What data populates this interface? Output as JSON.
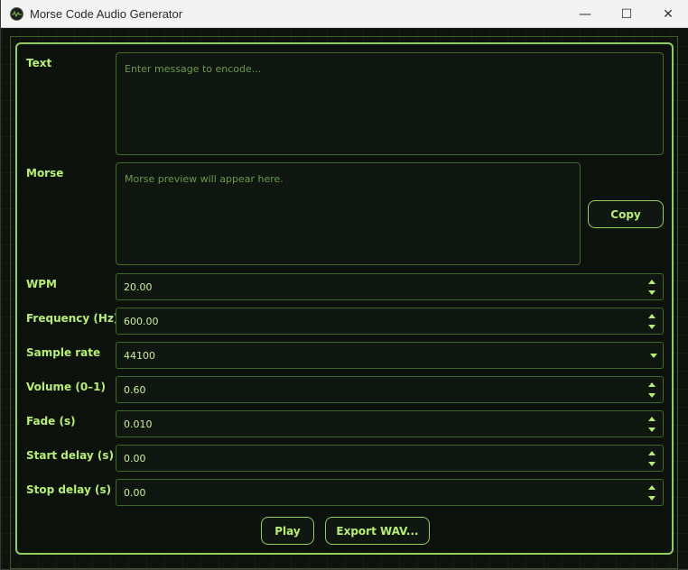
{
  "window": {
    "title": "Morse Code Audio Generator",
    "controls": {
      "minimize": "—",
      "maximize": "☐",
      "close": "✕"
    }
  },
  "form": {
    "text": {
      "label": "Text",
      "placeholder": "Enter message to encode...",
      "value": ""
    },
    "morse": {
      "label": "Morse",
      "placeholder": "Morse preview will appear here.",
      "value": ""
    },
    "copy_button": "Copy",
    "wpm": {
      "label": "WPM",
      "value": "20.00"
    },
    "frequency": {
      "label": "Frequency (Hz)",
      "value": "600.00"
    },
    "sample_rate": {
      "label": "Sample rate",
      "value": "44100"
    },
    "volume": {
      "label": "Volume (0–1)",
      "value": "0.60"
    },
    "fade": {
      "label": "Fade (s)",
      "value": "0.010"
    },
    "start_delay": {
      "label": "Start delay (s)",
      "value": "0.00"
    },
    "stop_delay": {
      "label": "Stop delay (s)",
      "value": "0.00"
    }
  },
  "actions": {
    "play": "Play",
    "export": "Export WAV..."
  },
  "colors": {
    "accent": "#b6f06d",
    "border": "#8fcf5a",
    "background": "#0e130e"
  }
}
